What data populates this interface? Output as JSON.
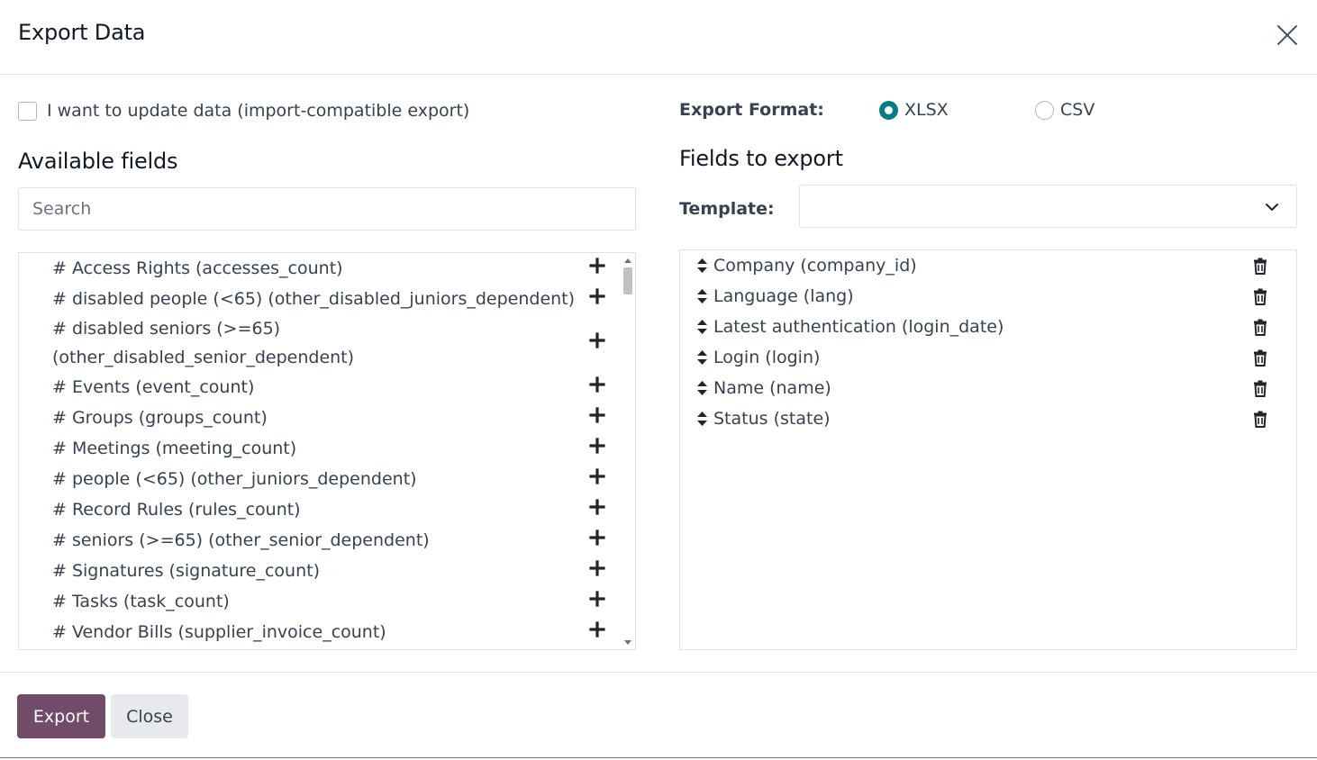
{
  "dialog": {
    "title": "Export Data",
    "close_icon": "close-icon"
  },
  "update_option": {
    "label": "I want to update data (import-compatible export)",
    "checked": false
  },
  "available": {
    "title": "Available fields",
    "search_placeholder": "Search",
    "fields": [
      "# Access Rights (accesses_count)",
      "# disabled people (<65) (other_disabled_juniors_dependent)",
      "# disabled seniors (>=65) (other_disabled_senior_dependent)",
      "# Events (event_count)",
      "# Groups (groups_count)",
      "# Meetings (meeting_count)",
      "# people (<65) (other_juniors_dependent)",
      "# Record Rules (rules_count)",
      "# seniors (>=65) (other_senior_dependent)",
      "# Signatures (signature_count)",
      "# Tasks (task_count)",
      "# Vendor Bills (supplier_invoice_count)"
    ]
  },
  "format": {
    "label": "Export Format:",
    "options": [
      {
        "label": "XLSX",
        "selected": true
      },
      {
        "label": "CSV",
        "selected": false
      }
    ]
  },
  "to_export": {
    "title": "Fields to export",
    "template_label": "Template:",
    "template_value": "",
    "fields": [
      "Company (company_id)",
      "Language (lang)",
      "Latest authentication (login_date)",
      "Login (login)",
      "Name (name)",
      "Status (state)"
    ]
  },
  "footer": {
    "export_label": "Export",
    "close_label": "Close"
  },
  "colors": {
    "accent": "#017e84",
    "primary_button": "#714b67",
    "secondary_button": "#e7e9ed"
  }
}
